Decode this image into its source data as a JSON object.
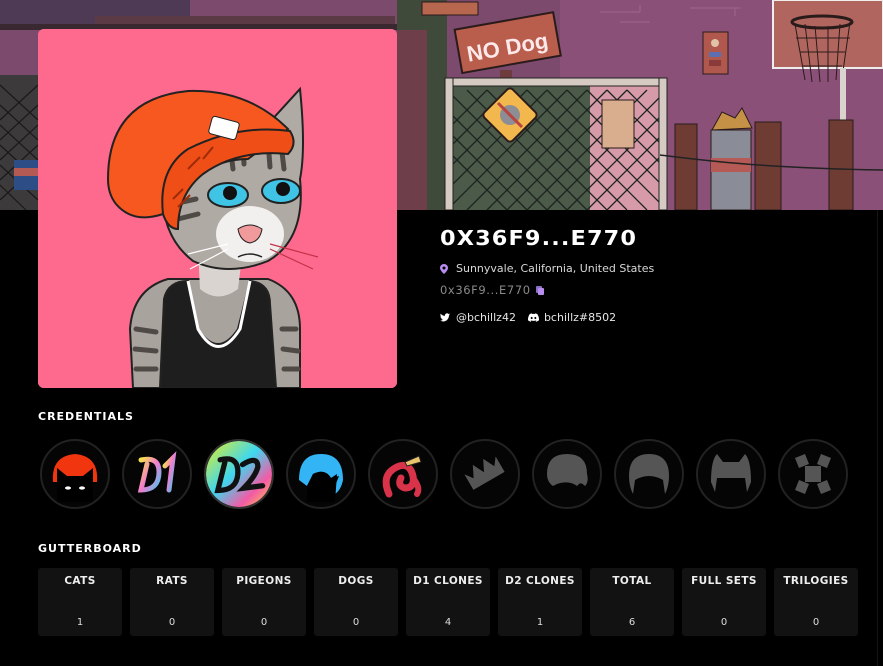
{
  "profile": {
    "title": "0X36F9...E770",
    "location": "Sunnyvale, California, United States",
    "address": "0x36F9...E770",
    "twitter": "@bchillz42",
    "discord": "bchillz#8502",
    "icons": {
      "location": "map-pin-icon",
      "copy": "copy-icon",
      "twitter": "twitter-icon",
      "discord": "discord-icon"
    },
    "accent_color": "#b98cf0"
  },
  "banner": {
    "sign_text": "NO Dog"
  },
  "avatar": {
    "description": "Cat wearing orange beanie and black tank top",
    "background_color": "#fd6a8d"
  },
  "credentials": {
    "title": "CREDENTIALS",
    "badges": [
      {
        "name": "cat-badge",
        "state": "earned"
      },
      {
        "name": "d1-badge",
        "label": "D1",
        "state": "earned"
      },
      {
        "name": "d2-badge",
        "label": "D2",
        "state": "earned"
      },
      {
        "name": "rat-badge",
        "state": "earned"
      },
      {
        "name": "worm-badge",
        "state": "earned"
      },
      {
        "name": "crown-badge",
        "state": "locked"
      },
      {
        "name": "dog-badge",
        "state": "locked"
      },
      {
        "name": "hair-badge",
        "state": "locked"
      },
      {
        "name": "cat-ears-badge",
        "state": "locked"
      },
      {
        "name": "crossbones-badge",
        "state": "locked"
      }
    ]
  },
  "gutterboard": {
    "title": "GUTTERBOARD",
    "stats": [
      {
        "label": "CATS",
        "value": "1"
      },
      {
        "label": "RATS",
        "value": "0"
      },
      {
        "label": "PIGEONS",
        "value": "0"
      },
      {
        "label": "DOGS",
        "value": "0"
      },
      {
        "label": "D1 CLONES",
        "value": "4"
      },
      {
        "label": "D2 CLONES",
        "value": "1"
      },
      {
        "label": "TOTAL",
        "value": "6"
      },
      {
        "label": "FULL SETS",
        "value": "0"
      },
      {
        "label": "TRILOGIES",
        "value": "0"
      }
    ]
  }
}
